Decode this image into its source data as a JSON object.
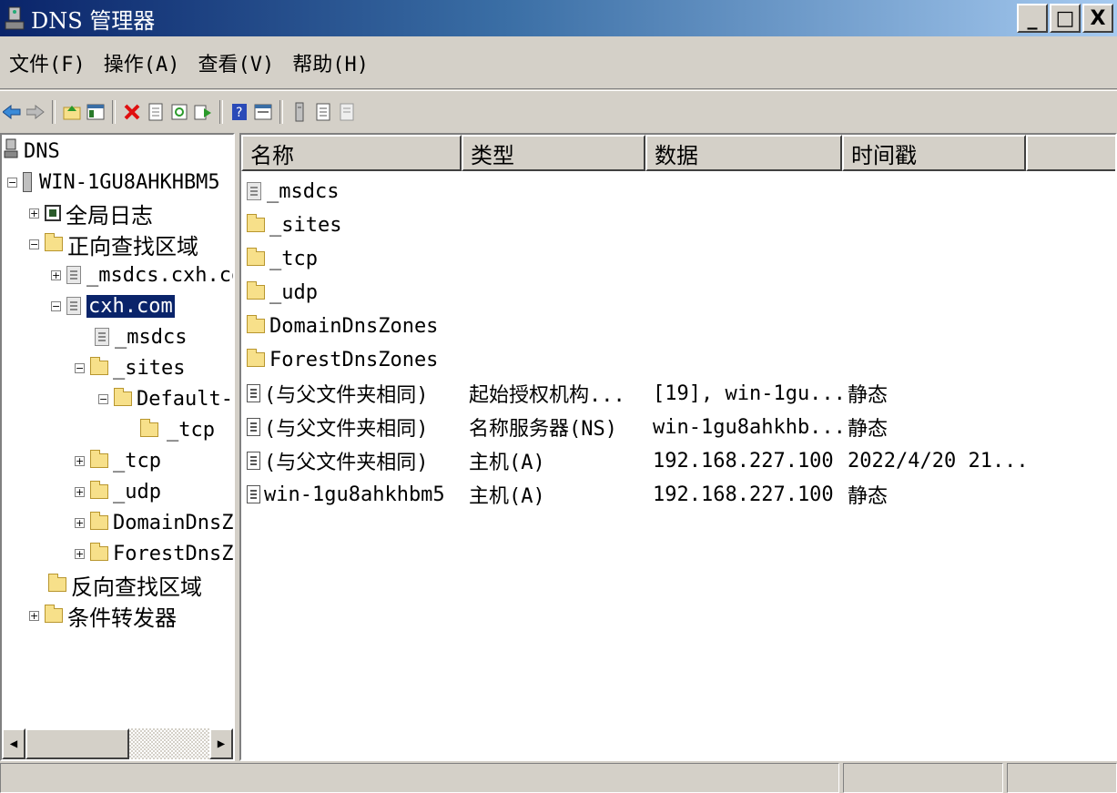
{
  "window": {
    "title": "DNS 管理器",
    "min_label": "_",
    "max_label": "□",
    "close_label": "X"
  },
  "menu": [
    {
      "label": "文件(F)"
    },
    {
      "label": "操作(A)"
    },
    {
      "label": "查看(V)"
    },
    {
      "label": "帮助(H)"
    }
  ],
  "tree": {
    "root": "DNS",
    "server": "WIN-1GU8AHKHBM5",
    "global_log": "全局日志",
    "forward_zones": "正向查找区域",
    "msdcs_zone": "_msdcs.cxh.co",
    "cxh_zone": "cxh.com",
    "msdcs": "_msdcs",
    "sites": "_sites",
    "default_site": "Default-F",
    "site_tcp": "_tcp",
    "tcp": "_tcp",
    "udp": "_udp",
    "domaindns": "DomainDnsZo",
    "forestdns": "ForestDnsZo",
    "reverse_zones": "反向查找区域",
    "conditional_forwarders": "条件转发器",
    "collapse_glyph": "−",
    "expand_glyph": "+"
  },
  "columns": [
    "名称",
    "类型",
    "数据",
    "时间戳"
  ],
  "rows": [
    {
      "icon": "zone",
      "name": "_msdcs",
      "type": "",
      "data": "",
      "timestamp": ""
    },
    {
      "icon": "folder",
      "name": "_sites",
      "type": "",
      "data": "",
      "timestamp": ""
    },
    {
      "icon": "folder",
      "name": "_tcp",
      "type": "",
      "data": "",
      "timestamp": ""
    },
    {
      "icon": "folder",
      "name": "_udp",
      "type": "",
      "data": "",
      "timestamp": ""
    },
    {
      "icon": "folder",
      "name": "DomainDnsZones",
      "type": "",
      "data": "",
      "timestamp": ""
    },
    {
      "icon": "folder",
      "name": "ForestDnsZones",
      "type": "",
      "data": "",
      "timestamp": ""
    },
    {
      "icon": "record",
      "name": "(与父文件夹相同)",
      "type": "起始授权机构...",
      "data": "[19], win-1gu...",
      "timestamp": "静态"
    },
    {
      "icon": "record",
      "name": "(与父文件夹相同)",
      "type": "名称服务器(NS)",
      "data": "win-1gu8ahkhb...",
      "timestamp": "静态"
    },
    {
      "icon": "record",
      "name": "(与父文件夹相同)",
      "type": "主机(A)",
      "data": "192.168.227.100",
      "timestamp": "2022/4/20 21..."
    },
    {
      "icon": "record",
      "name": "win-1gu8ahkhbm5",
      "type": "主机(A)",
      "data": "192.168.227.100",
      "timestamp": "静态"
    }
  ],
  "scroll": {
    "left_arrow": "◀",
    "right_arrow": "▶"
  },
  "colors": {
    "title_start": "#0a246a",
    "title_end": "#a6caf0",
    "selection": "#0a246a",
    "chrome": "#d4d0c8"
  }
}
